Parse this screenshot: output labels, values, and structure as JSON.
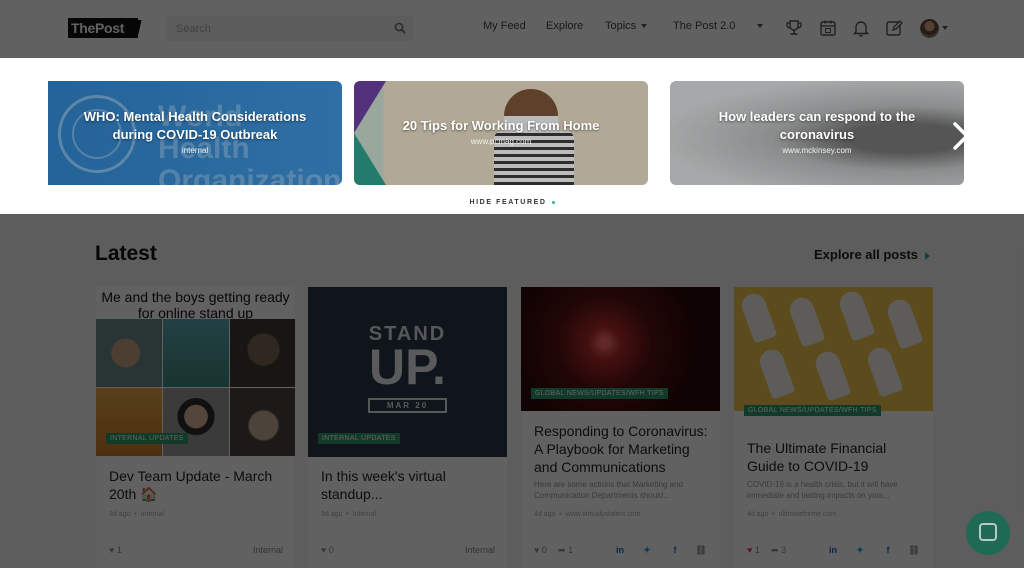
{
  "header": {
    "logo_text": "ThePost",
    "search_placeholder": "Search",
    "nav": {
      "my_feed": "My Feed",
      "explore": "Explore",
      "topics": "Topics",
      "workspace": "The Post 2.0"
    },
    "icons": [
      "trophy-icon",
      "calendar-icon",
      "bell-icon",
      "edit-icon"
    ]
  },
  "featured": {
    "cards": [
      {
        "title": "WHO: Mental Health Considerations during COVID-19 Outbreak",
        "source": "internal",
        "watermark": "World Health Organization"
      },
      {
        "title": "20 Tips for Working From Home",
        "source": "www.pcmag.com"
      },
      {
        "title": "How leaders can respond to the coronavirus",
        "source": "www.mckinsey.com"
      }
    ],
    "hide_label": "HIDE FEATURED"
  },
  "latest": {
    "title": "Latest",
    "explore_all": "Explore all posts",
    "posts": [
      {
        "image_caption": "Me and the boys getting ready for online stand up",
        "tag": "INTERNAL UPDATES",
        "title": "Dev Team Update - March 20th 🏠",
        "age": "3d ago",
        "source": "Internal",
        "likes": "1",
        "footer_label": "Internal"
      },
      {
        "image_line1": "STAND",
        "image_line2": "UP.",
        "image_date": "MAR 20",
        "tag": "INTERNAL UPDATES",
        "title": "In this week's virtual standup...",
        "age": "3d ago",
        "source": "Internal",
        "likes": "0",
        "footer_label": "Internal"
      },
      {
        "tag": "GLOBAL NEWS/UPDATES/WFH TIPS",
        "title": "Responding to Coronavirus: A Playbook for Marketing and Communications",
        "excerpt": "Here are some actions that Marketing and Communication Departments should...",
        "age": "4d ago",
        "source": "www.virtualystalent.com",
        "likes": "0",
        "shares": "1"
      },
      {
        "tag": "GLOBAL NEWS/UPDATES/WFH TIPS",
        "title": "The Ultimate Financial Guide to COVID-19",
        "excerpt": "COVID-19 is a health crisis, but it will have immediate and lasting impacts on your...",
        "age": "4d ago",
        "source": "ultimateforme.com",
        "likes": "1",
        "shares": "3"
      }
    ]
  },
  "colors": {
    "accent": "#2ab3a6",
    "tag_green": "#2f9c6b",
    "overlay": "rgba(0,0,0,0.62)",
    "intercom": "#2ea885"
  }
}
